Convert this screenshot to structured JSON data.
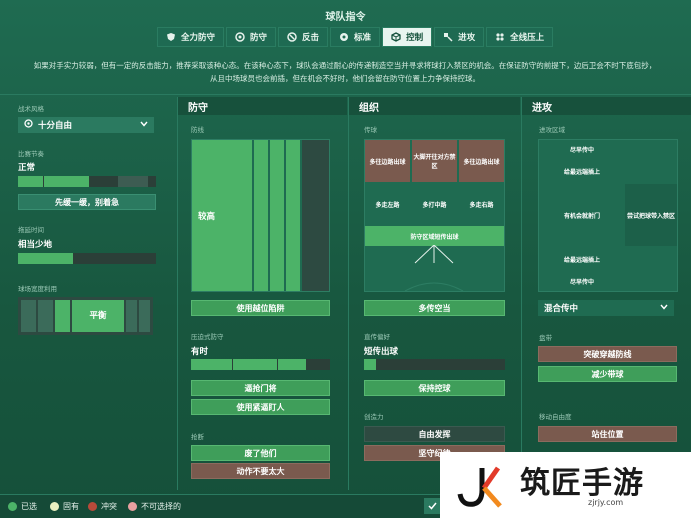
{
  "title": "球队指令",
  "tabs": [
    {
      "label": "全力防守",
      "icon": "shield-heart-icon",
      "active": false
    },
    {
      "label": "防守",
      "icon": "shield-icon",
      "active": false
    },
    {
      "label": "反击",
      "icon": "counter-icon",
      "active": false
    },
    {
      "label": "标准",
      "icon": "ball-icon",
      "active": false
    },
    {
      "label": "控制",
      "icon": "cube-icon",
      "active": true
    },
    {
      "label": "进攻",
      "icon": "attack-icon",
      "active": false
    },
    {
      "label": "全线压上",
      "icon": "press-icon",
      "active": false
    }
  ],
  "description_lines": [
    "如果对手实力较弱，但有一定的反击能力，推荐采取该种心态。在该种心态下，球队会通过耐心的传递制造空当并寻求将球打入禁区的机会。在保证防守的前提下，边后卫会不时下底包抄，",
    "从且中场球员也会前插，但在机会不好时，他们会留在防守位置上力争保持控球。"
  ],
  "left": {
    "tactic_style_label": "战术风格",
    "tactic_style_value": "十分自由",
    "tempo_label": "比赛节奏",
    "tempo_value": "正常",
    "tempo_fill": 0.5,
    "tempo_button": "先缓一缓，别着急",
    "time_wasting_label": "拖延时间",
    "time_wasting_value": "相当少地",
    "time_wasting_fill": 0.22,
    "width_label": "球场宽度利用",
    "width_value": "平衡"
  },
  "defense": {
    "header": "防守",
    "line_label": "防线",
    "line_value": "较高",
    "offside_button": "使用越位陷阱",
    "pressing_label": "压迫式防守",
    "pressing_value": "有时",
    "tackle_button": "逼抢门将",
    "marking_button": "使用紧逼盯人",
    "tackling_label": "抢断",
    "tackling_btn1": "废了他们",
    "tackling_btn2": "动作不要太大"
  },
  "organise": {
    "header": "组织",
    "passing_label": "传球",
    "zones": [
      "多往边路出球",
      "大脚开往对方禁区",
      "多往边路出球",
      "多走左路",
      "多打中路",
      "多走右路",
      "防守区域短传出球"
    ],
    "passing_button": "多传空当",
    "style_label": "直传偏好",
    "style_value": "短传出球",
    "possession_button": "保持控球",
    "creativity_label": "创造力",
    "creativity_btn1": "自由发挥",
    "creativity_btn2": "坚守纪律"
  },
  "attack": {
    "header": "进攻",
    "area_label": "进攻区域",
    "zones": [
      "尽早传中",
      "给最远端插上",
      "有机会就射门",
      "尝试把球带入禁区",
      "给最远端插上",
      "尽早传中"
    ],
    "crossing_value": "混合传中",
    "dribble_label": "盘带",
    "dribble_btn1": "突破穿越防线",
    "dribble_btn2": "减少带球",
    "movement_label": "移动自由度",
    "movement_btn1": "站住位置"
  },
  "legend": [
    {
      "label": "已选",
      "color": "#4cb368"
    },
    {
      "label": "固有",
      "color": "#e8f0c0"
    },
    {
      "label": "冲突",
      "color": "#b84a3a"
    },
    {
      "label": "不可选择的",
      "color": "#e8a0a0"
    }
  ],
  "watermark": {
    "title": "筑匠手游",
    "url": "zjrjy.com",
    "logo_letters": "JK"
  }
}
